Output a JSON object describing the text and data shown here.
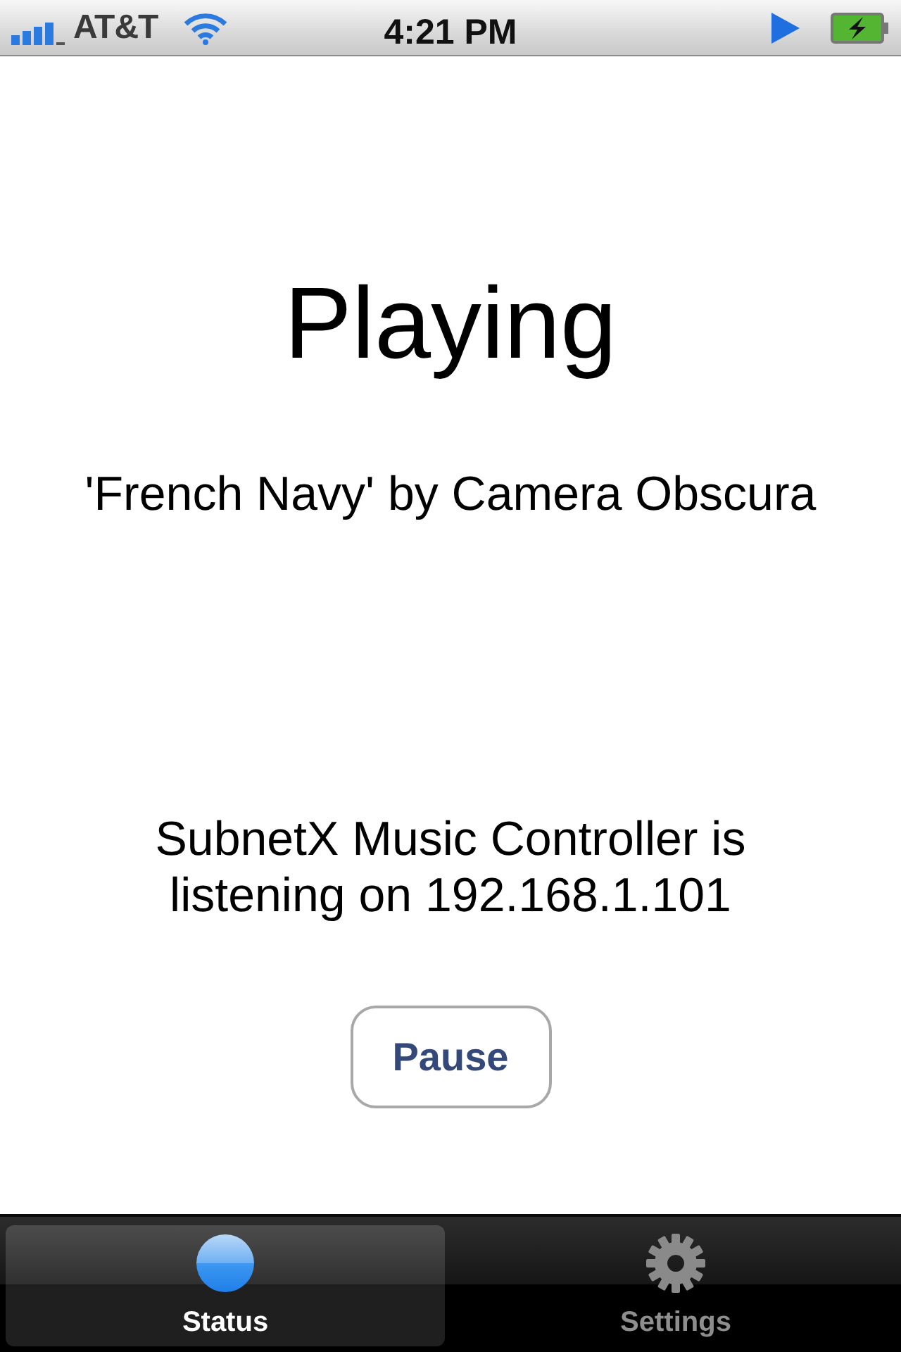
{
  "status_bar": {
    "carrier": "AT&T",
    "time": "4:21 PM"
  },
  "status": {
    "title": "Playing",
    "track": "'French Navy' by Camera Obscura",
    "message": "SubnetX Music Controller is listening on 192.168.1.101",
    "button": "Pause"
  },
  "tab_bar": {
    "tabs": [
      {
        "label": "Status",
        "kind": "status",
        "selected": true
      },
      {
        "label": "Settings",
        "kind": "settings",
        "selected": false
      }
    ]
  }
}
